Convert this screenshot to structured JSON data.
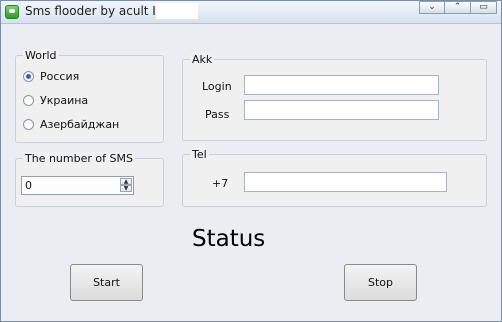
{
  "window": {
    "title": "Sms flooder by acult ICQ:",
    "controls": [
      "minimize",
      "maximize",
      "close"
    ]
  },
  "world": {
    "legend": "World",
    "options": [
      "Россия",
      "Украина",
      "Азербайджан"
    ],
    "selected": "Россия"
  },
  "akk": {
    "legend": "Akk",
    "login_label": "Login",
    "login_value": "",
    "pass_label": "Pass",
    "pass_value": ""
  },
  "sms": {
    "legend": "The number of SMS",
    "value": "0"
  },
  "tel": {
    "legend": "Tel",
    "prefix": "+7",
    "value": ""
  },
  "status": "Status",
  "buttons": {
    "start": "Start",
    "stop": "Stop"
  }
}
